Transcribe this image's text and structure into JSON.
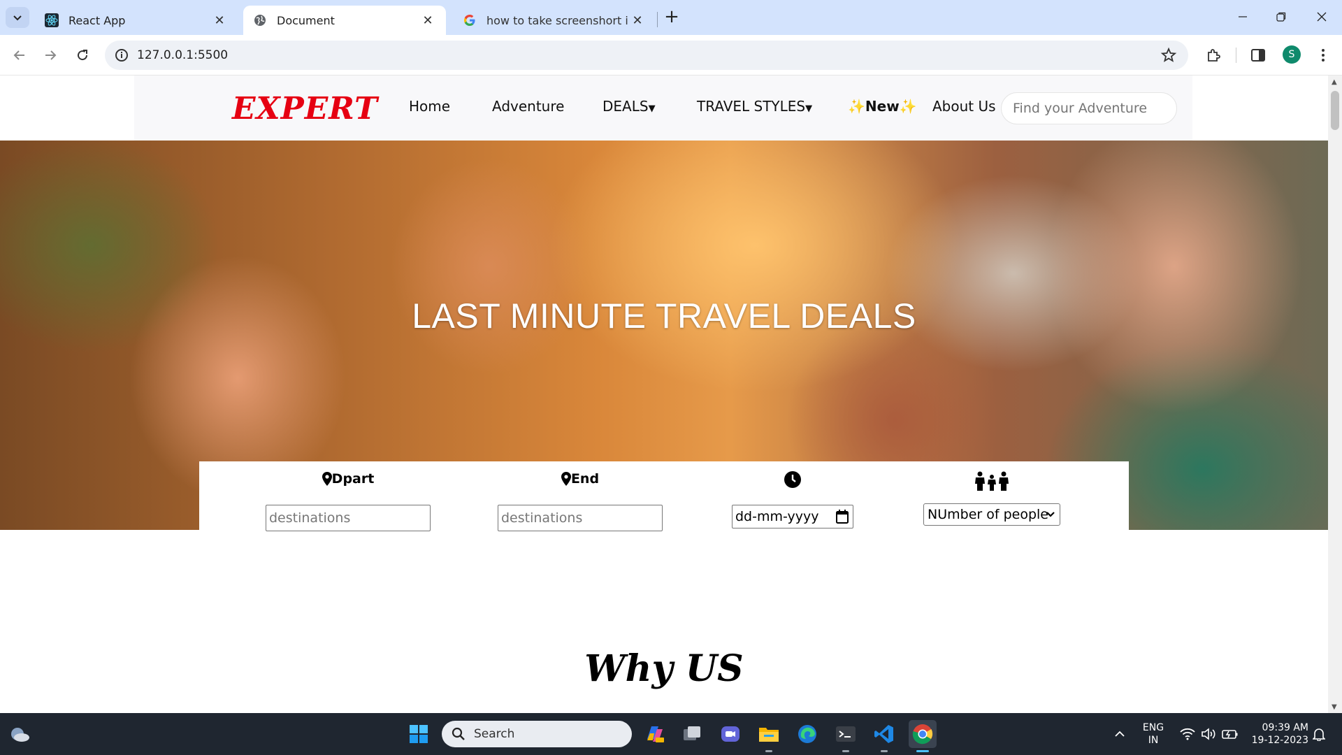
{
  "browser": {
    "tabs": [
      {
        "title": "React App",
        "favicon": "react-icon",
        "active": false
      },
      {
        "title": "Document",
        "favicon": "globe-icon",
        "active": true
      },
      {
        "title": "how to take screenshort in lapto",
        "favicon": "google-icon",
        "active": false
      }
    ],
    "url": "127.0.0.1:5500",
    "profile_initial": "S"
  },
  "site": {
    "logo": "EXPERT",
    "nav": {
      "home": "Home",
      "adventure": "Adventure",
      "deals": "DEALS",
      "travel_styles": "TRAVEL STYLES",
      "new": "New",
      "about": "About Us"
    },
    "search_placeholder": "Find your Adventure",
    "hero_title": "LAST MINUTE TRAVEL DEALS",
    "booking": {
      "depart_label": "Dpart",
      "end_label": "End",
      "depart_placeholder": "destinations",
      "end_placeholder": "destinations",
      "date_placeholder": "dd-mm-yyyy",
      "people_select": "NUmber of people"
    },
    "why_heading": "Why US"
  },
  "taskbar": {
    "search": "Search",
    "lang_top": "ENG",
    "lang_bottom": "IN",
    "time": "09:39 AM",
    "date": "19-12-2023"
  },
  "colors": {
    "logo": "#e60012",
    "tabstrip": "#d3e3fd",
    "taskbar": "#1f2630"
  }
}
